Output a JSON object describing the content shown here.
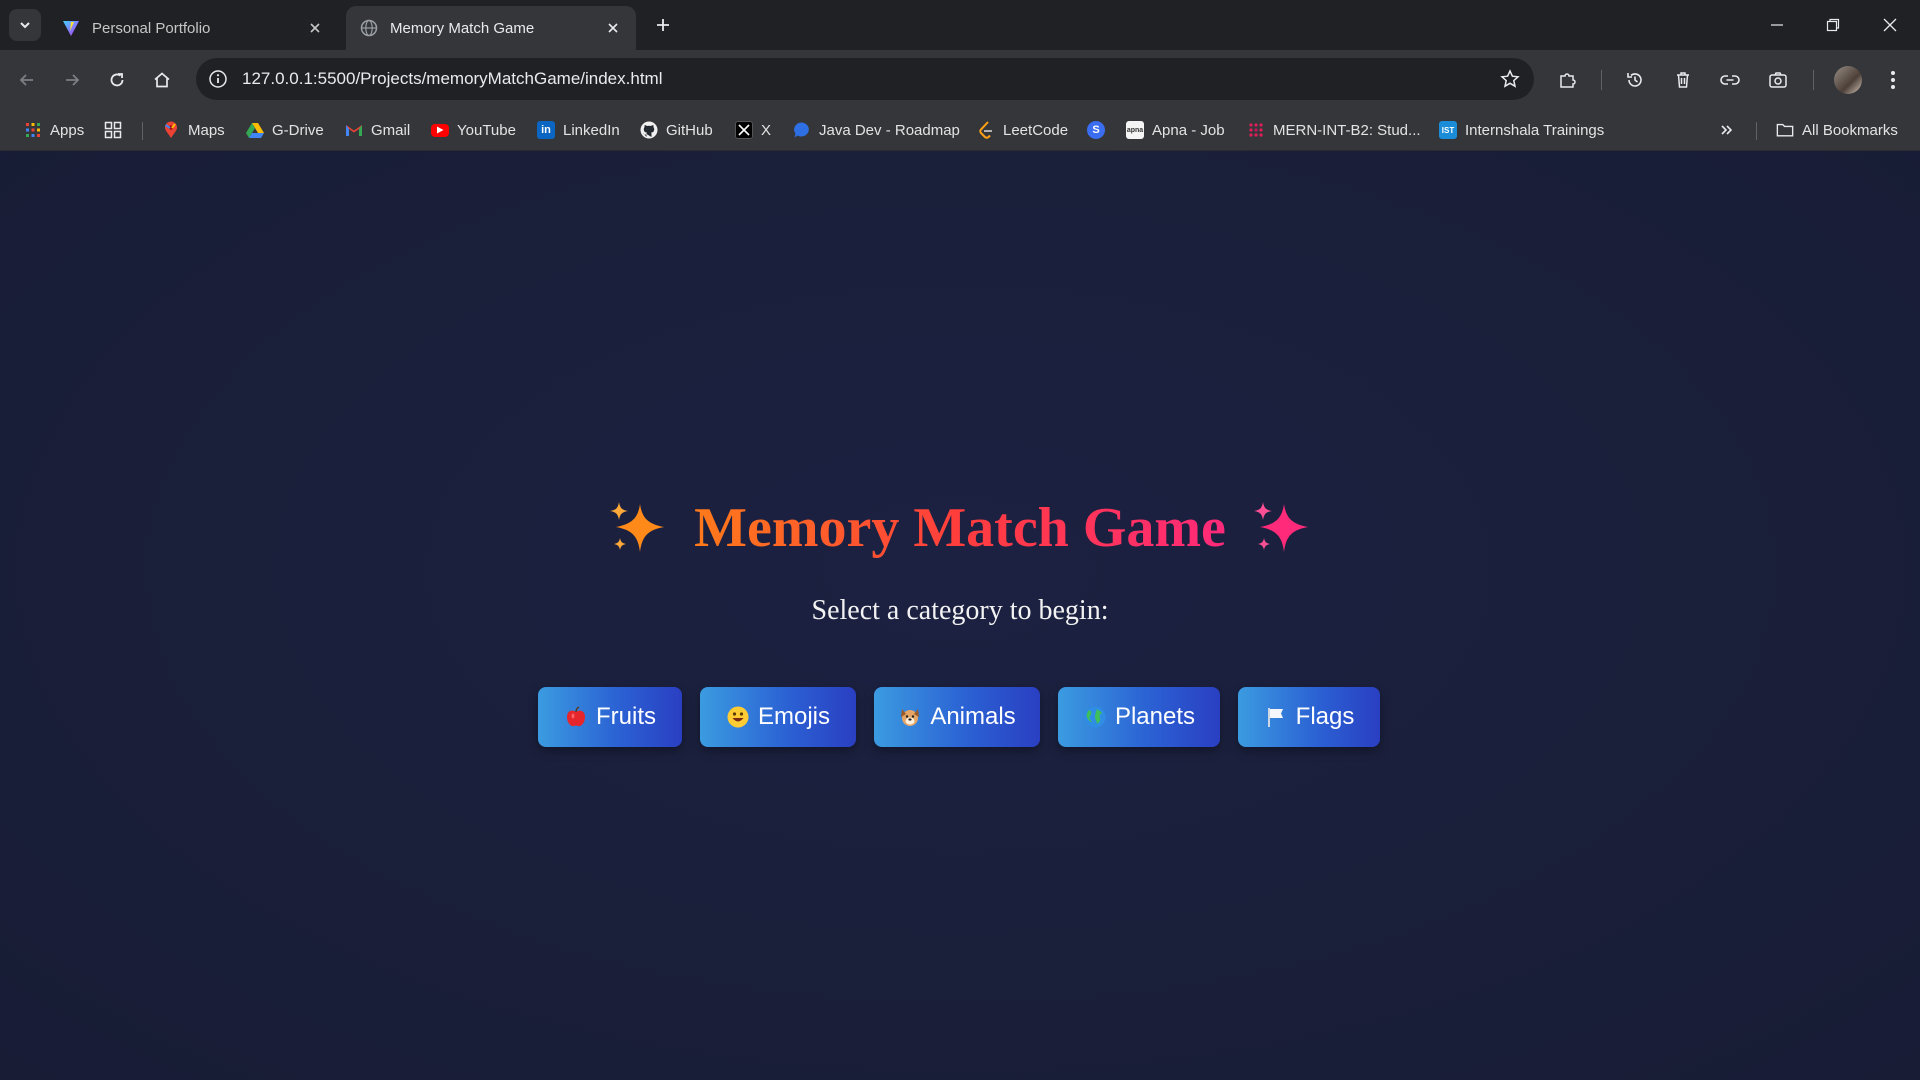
{
  "browser": {
    "tabs": [
      {
        "title": "Personal Portfolio",
        "favicon": "vite-logo-icon",
        "active": false
      },
      {
        "title": "Memory Match Game",
        "favicon": "globe-icon",
        "active": true
      }
    ],
    "url": "127.0.0.1:5500/Projects/memoryMatchGame/index.html",
    "bookmarks": [
      {
        "label": "Apps",
        "icon": "apps-grid-icon"
      },
      {
        "label": "Maps",
        "icon": "maps-pin-icon"
      },
      {
        "label": "G-Drive",
        "icon": "drive-icon"
      },
      {
        "label": "Gmail",
        "icon": "gmail-icon"
      },
      {
        "label": "YouTube",
        "icon": "youtube-icon"
      },
      {
        "label": "LinkedIn",
        "icon": "linkedin-icon"
      },
      {
        "label": "GitHub",
        "icon": "github-icon"
      },
      {
        "label": "X",
        "icon": "x-icon"
      },
      {
        "label": "Java Dev - Roadmap",
        "icon": "chat-bubble-icon"
      },
      {
        "label": "LeetCode",
        "icon": "leetcode-icon"
      },
      {
        "label": "Apna - Job",
        "icon": "apna-icon"
      },
      {
        "label": "MERN-INT-B2: Stud...",
        "icon": "slack-icon"
      },
      {
        "label": "Internshala Trainings",
        "icon": "ist-icon"
      }
    ],
    "all_bookmarks_label": "All Bookmarks"
  },
  "game": {
    "title": "Memory Match Game",
    "subtitle": "Select a category to begin:",
    "categories": [
      {
        "label": "Fruits",
        "icon": "apple-icon"
      },
      {
        "label": "Emojis",
        "icon": "smiley-icon"
      },
      {
        "label": "Animals",
        "icon": "dog-icon"
      },
      {
        "label": "Planets",
        "icon": "earth-icon"
      },
      {
        "label": "Flags",
        "icon": "flag-icon"
      }
    ]
  },
  "colors": {
    "page_bg": "#1a1f3a",
    "title_gradient_start": "#ff7a1a",
    "title_gradient_end": "#ff2a7a",
    "button_gradient_start": "#3b9be0",
    "button_gradient_end": "#2a3fc2"
  }
}
